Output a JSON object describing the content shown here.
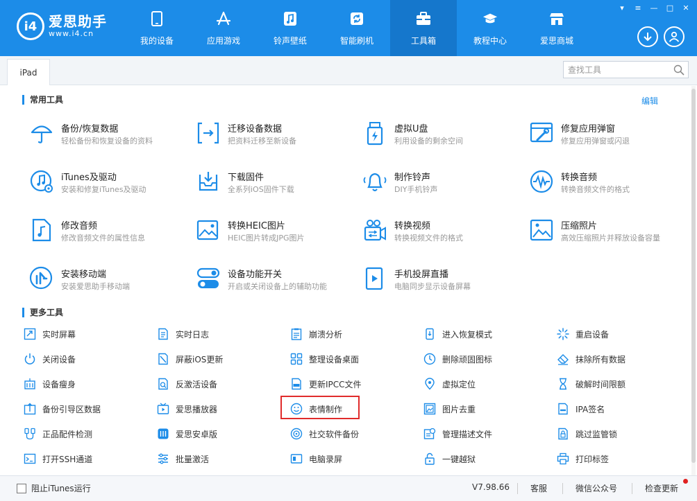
{
  "app": {
    "name": "爱思助手",
    "url": "www.i4.cn",
    "logo_mark": "i4",
    "brand_color": "#1c8ce8",
    "accent_color": "#e02b2b"
  },
  "nav": [
    {
      "label": "我的设备",
      "icon": "phone-icon"
    },
    {
      "label": "应用游戏",
      "icon": "appstore-icon"
    },
    {
      "label": "铃声壁纸",
      "icon": "music-icon"
    },
    {
      "label": "智能刷机",
      "icon": "refresh-icon"
    },
    {
      "label": "工具箱",
      "icon": "toolbox-icon",
      "active": true
    },
    {
      "label": "教程中心",
      "icon": "graduation-cap-icon"
    },
    {
      "label": "爱思商城",
      "icon": "shop-icon"
    }
  ],
  "tab": {
    "label": "iPad"
  },
  "search": {
    "placeholder": "查找工具"
  },
  "common": {
    "title": "常用工具",
    "edit_label": "编辑",
    "tools": [
      {
        "title": "备份/恢复数据",
        "desc": "轻松备份和恢复设备的资料",
        "icon": "umbrella-icon"
      },
      {
        "title": "迁移设备数据",
        "desc": "把资料迁移至新设备",
        "icon": "transfer-icon"
      },
      {
        "title": "虚拟U盘",
        "desc": "利用设备的剩余空间",
        "icon": "usb-drive-icon"
      },
      {
        "title": "修复应用弹窗",
        "desc": "修复应用弹窗或闪退",
        "icon": "repair-window-icon"
      },
      {
        "title": "iTunes及驱动",
        "desc": "安装和修复iTunes及驱动",
        "icon": "itunes-icon"
      },
      {
        "title": "下载固件",
        "desc": "全系列iOS固件下载",
        "icon": "download-tray-icon"
      },
      {
        "title": "制作铃声",
        "desc": "DIY手机铃声",
        "icon": "bell-icon"
      },
      {
        "title": "转换音频",
        "desc": "转换音频文件的格式",
        "icon": "audio-wave-icon"
      },
      {
        "title": "修改音频",
        "desc": "修改音频文件的属性信息",
        "icon": "music-file-icon"
      },
      {
        "title": "转换HEIC图片",
        "desc": "HEIC图片转成JPG图片",
        "icon": "image-convert-icon"
      },
      {
        "title": "转换视频",
        "desc": "转换视频文件的格式",
        "icon": "video-convert-icon"
      },
      {
        "title": "压缩照片",
        "desc": "高效压缩照片并释放设备容量",
        "icon": "photo-compress-icon"
      },
      {
        "title": "安装移动端",
        "desc": "安装爱思助手移动端",
        "icon": "i4-mobile-icon"
      },
      {
        "title": "设备功能开关",
        "desc": "开启或关闭设备上的辅助功能",
        "icon": "toggle-switch-icon"
      },
      {
        "title": "手机投屏直播",
        "desc": "电脑同步显示设备屏幕",
        "icon": "screen-cast-icon"
      }
    ]
  },
  "more": {
    "title": "更多工具",
    "tools": [
      {
        "label": "实时屏幕",
        "icon": "realtime-screen-icon"
      },
      {
        "label": "实时日志",
        "icon": "log-icon"
      },
      {
        "label": "崩溃分析",
        "icon": "crash-report-icon"
      },
      {
        "label": "进入恢复模式",
        "icon": "recovery-mode-icon"
      },
      {
        "label": "重启设备",
        "icon": "restart-icon"
      },
      {
        "label": "关闭设备",
        "icon": "power-icon"
      },
      {
        "label": "屏蔽iOS更新",
        "icon": "block-update-icon"
      },
      {
        "label": "整理设备桌面",
        "icon": "grid-icon"
      },
      {
        "label": "删除顽固图标",
        "icon": "delete-icon-icon"
      },
      {
        "label": "抹除所有数据",
        "icon": "eraser-icon"
      },
      {
        "label": "设备瘦身",
        "icon": "broom-icon"
      },
      {
        "label": "反激活设备",
        "icon": "deactivate-icon"
      },
      {
        "label": "更新IPCC文件",
        "icon": "ipcc-file-icon"
      },
      {
        "label": "虚拟定位",
        "icon": "location-pin-icon"
      },
      {
        "label": "破解时间限额",
        "icon": "hourglass-icon"
      },
      {
        "label": "备份引导区数据",
        "icon": "backup-boot-icon"
      },
      {
        "label": "爱思播放器",
        "icon": "tv-player-icon"
      },
      {
        "label": "表情制作",
        "icon": "smiley-icon"
      },
      {
        "label": "图片去重",
        "icon": "image-dedupe-icon"
      },
      {
        "label": "IPA签名",
        "icon": "ipa-sign-icon"
      },
      {
        "label": "正品配件检测",
        "icon": "cable-check-icon"
      },
      {
        "label": "爱思安卓版",
        "icon": "i4-android-icon"
      },
      {
        "label": "社交软件备份",
        "icon": "social-backup-icon"
      },
      {
        "label": "管理描述文件",
        "icon": "profile-settings-icon"
      },
      {
        "label": "跳过监管锁",
        "icon": "skip-lock-icon"
      },
      {
        "label": "打开SSH通道",
        "icon": "terminal-icon"
      },
      {
        "label": "批量激活",
        "icon": "batch-activate-icon"
      },
      {
        "label": "电脑录屏",
        "icon": "screen-record-icon"
      },
      {
        "label": "一键越狱",
        "icon": "unlock-icon"
      },
      {
        "label": "打印标签",
        "icon": "printer-icon"
      }
    ]
  },
  "footer": {
    "block_itunes_label": "阻止iTunes运行",
    "block_itunes_checked": false,
    "version": "V7.98.66",
    "support": "客服",
    "wechat": "微信公众号",
    "check_update": "检查更新"
  }
}
